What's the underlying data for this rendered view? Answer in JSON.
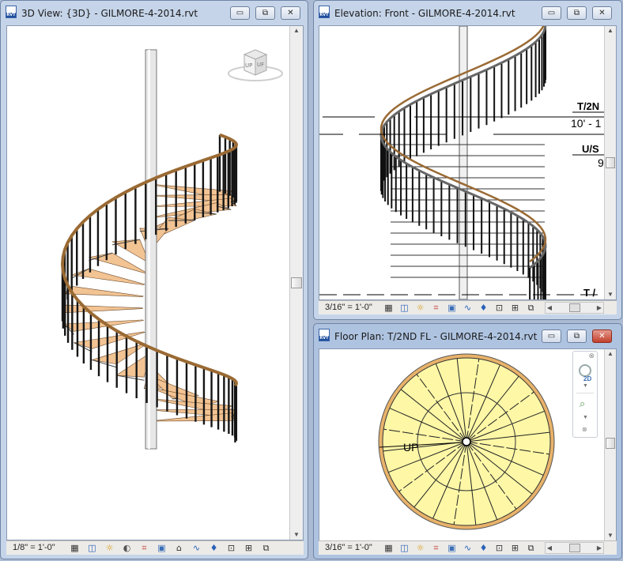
{
  "windows": {
    "view3d": {
      "title": "3D View: {3D} - GILMORE-4-2014.rvt",
      "scale": "1/8\" = 1'-0\"",
      "app_badge": "RVT",
      "viewcube_labels": {
        "left_face": "UP",
        "right_face": "UF"
      }
    },
    "elevation": {
      "title": "Elevation: Front - GILMORE-4-2014.rvt",
      "scale": "3/16\" = 1'-0\"",
      "app_badge": "RVT",
      "level_tags": [
        {
          "name": "T/2N",
          "value": "10' - 1"
        },
        {
          "name": "U/S",
          "value": "9"
        },
        {
          "name": "T /",
          "value": ""
        }
      ]
    },
    "floorplan": {
      "title": "Floor Plan: T/2ND FL - GILMORE-4-2014.rvt",
      "scale": "3/16\" = 1'-0\"",
      "app_badge": "RVT",
      "annotation": "UP",
      "nav_2d_label": "2D"
    }
  },
  "window_controls": {
    "minimize": "▭",
    "restore": "⧉",
    "close": "✕"
  },
  "colors": {
    "tread": "#f2c393",
    "handrail": "#9a6a34",
    "plan_fill": "#fdf7a6",
    "plan_rim": "#e8b26a",
    "titlebar_active": "#aec3e0",
    "close_active": "#c2402c"
  }
}
